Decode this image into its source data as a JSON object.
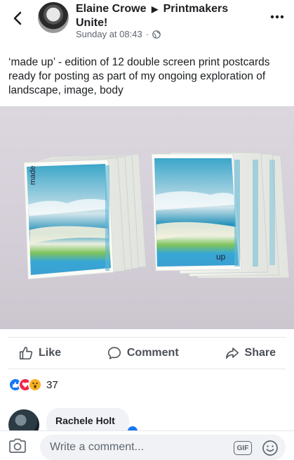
{
  "header": {
    "author": "Elaine Crowe",
    "arrow": "▶",
    "group": "Printmakers Unite!",
    "timestamp": "Sunday at 08:43",
    "separator": "·",
    "icons": {
      "back": "chevron-left-icon",
      "privacy": "globe-icon",
      "more": "more-dots-icon"
    }
  },
  "post": {
    "text": "‘made up’ - edition of 12 double screen print postcards ready for posting as part of my ongoing exploration of landscape, image, body",
    "photo": {
      "left_card_text": "made",
      "right_card_text": "up"
    }
  },
  "actions": [
    {
      "label": "Like",
      "icon": "thumbs-up-icon"
    },
    {
      "label": "Comment",
      "icon": "comment-icon"
    },
    {
      "label": "Share",
      "icon": "share-icon"
    }
  ],
  "reactions": {
    "types": [
      "like",
      "love",
      "wow"
    ],
    "count": "37"
  },
  "comment": {
    "author": "Rachele Holt"
  },
  "composer": {
    "placeholder": "Write a comment...",
    "gif_label": "GIF",
    "icons": {
      "camera": "camera-icon",
      "emoji": "emoji-icon"
    }
  },
  "colors": {
    "accent": "#1877f2",
    "love": "#f0284a",
    "wow": "#f7b125",
    "muted_text": "#606770"
  }
}
